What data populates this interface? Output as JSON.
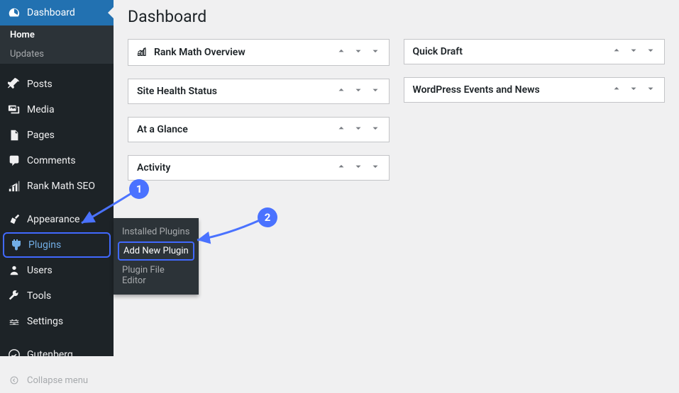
{
  "sidebar": {
    "dashboard": {
      "label": "Dashboard"
    },
    "submenu": {
      "home": "Home",
      "updates": "Updates"
    },
    "items": [
      {
        "label": "Posts"
      },
      {
        "label": "Media"
      },
      {
        "label": "Pages"
      },
      {
        "label": "Comments"
      },
      {
        "label": "Rank Math SEO"
      }
    ],
    "appearance": {
      "label": "Appearance"
    },
    "plugins": {
      "label": "Plugins"
    },
    "users": {
      "label": "Users"
    },
    "tools": {
      "label": "Tools"
    },
    "settings": {
      "label": "Settings"
    },
    "gutenberg": {
      "label": "Gutenberg"
    },
    "collapse": {
      "label": "Collapse menu"
    }
  },
  "pluginsFlyout": {
    "installed": "Installed Plugins",
    "addnew": "Add New Plugin",
    "editor": "Plugin File Editor"
  },
  "page": {
    "title": "Dashboard"
  },
  "dashboxes": {
    "rankmath": "Rank Math Overview",
    "sitehealth": "Site Health Status",
    "ataglance": "At a Glance",
    "activity": "Activity",
    "quickdraft": "Quick Draft",
    "wpevents": "WordPress Events and News"
  },
  "annotations": {
    "badge1": "1",
    "badge2": "2"
  }
}
